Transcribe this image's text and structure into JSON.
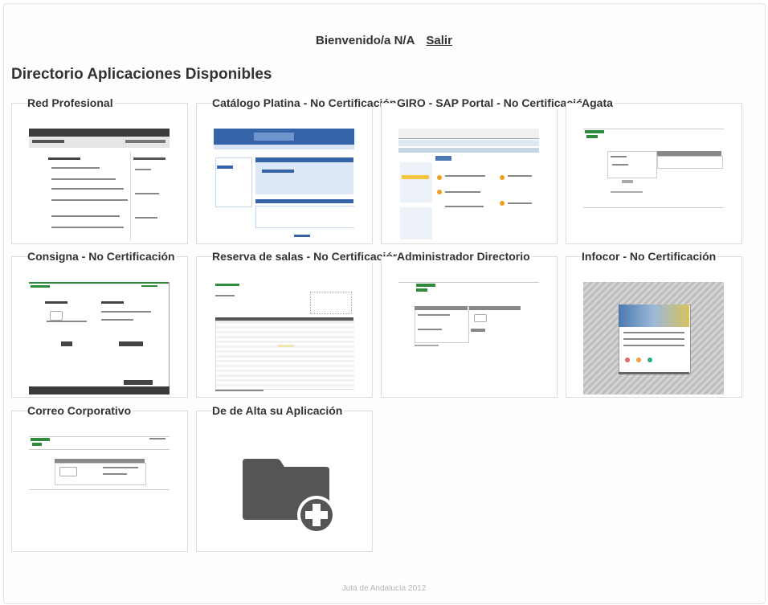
{
  "header": {
    "welcome": "Bienvenido/a N/A",
    "logout_label": "Salir"
  },
  "page": {
    "title": "Directorio Aplicaciones Disponibles"
  },
  "apps": [
    {
      "name": "Red Profesional"
    },
    {
      "name": "Catálogo Platina - No Certificación"
    },
    {
      "name": "GIRO - SAP Portal - No Certificación"
    },
    {
      "name": "Agata"
    },
    {
      "name": "Consigna - No Certificación"
    },
    {
      "name": "Reserva de salas - No Certificación"
    },
    {
      "name": "Administrador Directorio"
    },
    {
      "name": "Infocor - No Certificación"
    },
    {
      "name": "Correo Corporativo"
    },
    {
      "name": "De de Alta su Aplicación"
    }
  ],
  "icons": {
    "add_app": "folder-plus-icon"
  },
  "footer": {
    "text": "Juta de Andalucía 2012"
  },
  "colors": {
    "brand_green": "#2e8b3c",
    "icon_grey": "#555555"
  }
}
